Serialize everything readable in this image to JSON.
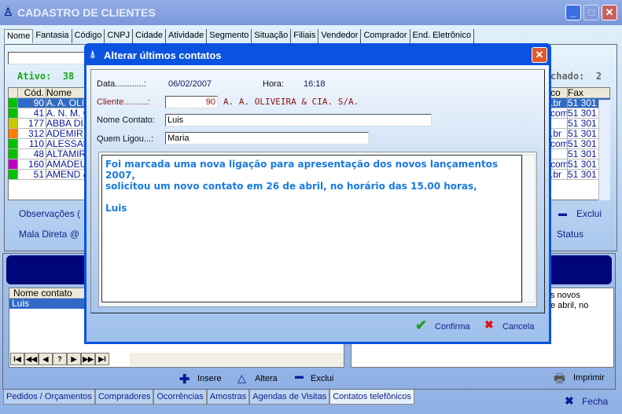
{
  "window": {
    "title": "CADASTRO DE CLIENTES",
    "minimize": "_",
    "maximize": "□",
    "close": "✕"
  },
  "tabs": [
    "Nome",
    "Fantasia",
    "Código",
    "CNPJ",
    "Cidade",
    "Atividade",
    "Segmento",
    "Situação",
    "Filiais",
    "Vendedor",
    "Comprador",
    "End. Eletrônico"
  ],
  "search": {
    "value": ""
  },
  "status": {
    "ativo_label": "Ativo:",
    "ativo_value": "38",
    "fechado_label": "chado:",
    "fechado_value": "2"
  },
  "grid": {
    "headers": {
      "cod": "Cód.",
      "nome": "Nome",
      "co": "co",
      "fax": "Fax"
    },
    "rows": [
      {
        "color": "#00c000",
        "cod": "90",
        "nome": "A. A. OLIV",
        "co": ".br",
        "fax": "51 301"
      },
      {
        "color": "#00c000",
        "cod": "41",
        "nome": "A. N. M. C",
        "co": "com",
        "fax": "51 301"
      },
      {
        "color": "#c8c800",
        "cod": "177",
        "nome": "ABBA DIS",
        "co": "",
        "fax": "51 301"
      },
      {
        "color": "#ff8000",
        "cod": "312",
        "nome": "ADEMIR",
        "co": ".br",
        "fax": "51 301"
      },
      {
        "color": "#00c000",
        "cod": "110",
        "nome": "ALESSAN",
        "co": "com",
        "fax": "51 301"
      },
      {
        "color": "#00c000",
        "cod": "48",
        "nome": "ALTAMIR",
        "co": "",
        "fax": "51 301"
      },
      {
        "color": "#c000c0",
        "cod": "160",
        "nome": "AMADEU",
        "co": "com",
        "fax": "51 301"
      },
      {
        "color": "#00c000",
        "cod": "51",
        "nome": "AMEND &",
        "co": ".br",
        "fax": "51 301"
      }
    ]
  },
  "observacoes": "Observações (",
  "mala_direta": "Mala Direta @",
  "top_actions": {
    "exclui": "Exclui",
    "status": "Status"
  },
  "contacts": {
    "header": "Nome contato",
    "rows": [
      "Luis"
    ],
    "memo_lines": [
      "s novos",
      "e abril, no"
    ]
  },
  "nav_buttons": [
    "I◀",
    "◀◀",
    "◀",
    "?",
    "▶",
    "▶▶",
    "▶I"
  ],
  "bottom_actions": {
    "insere": "Insere",
    "altera": "Altera",
    "exclui": "Exclui",
    "imprimir": "Imprimir",
    "fecha": "Fecha"
  },
  "bottom_tabs": [
    "Pedidos / Orçamentos",
    "Compradores",
    "Ocorrências",
    "Amostras",
    "Agendas de Visitas",
    "Contatos telefônicos"
  ],
  "dialog": {
    "title": "Alterar últimos contatos",
    "data_label": "Data............:",
    "data_value": "06/02/2007",
    "hora_label": "Hora:",
    "hora_value": "16:18",
    "cliente_label": "Cliente..........:",
    "cliente_code": "90",
    "cliente_name": "A. A. OLIVEIRA & CIA. S/A.",
    "nome_contato_label": "Nome Contato:",
    "nome_contato_value": "Luis",
    "quem_ligou_label": "Quem Ligou...:",
    "quem_ligou_value": "Maria",
    "memo": [
      "Foi marcada uma nova ligação para apresentação dos novos lançamentos 2007,",
      "solicitou um novo contato em 26 de abril, no horário das 15.00 horas,",
      "",
      "Luis"
    ],
    "confirma": "Confirma",
    "cancela": "Cancela"
  }
}
